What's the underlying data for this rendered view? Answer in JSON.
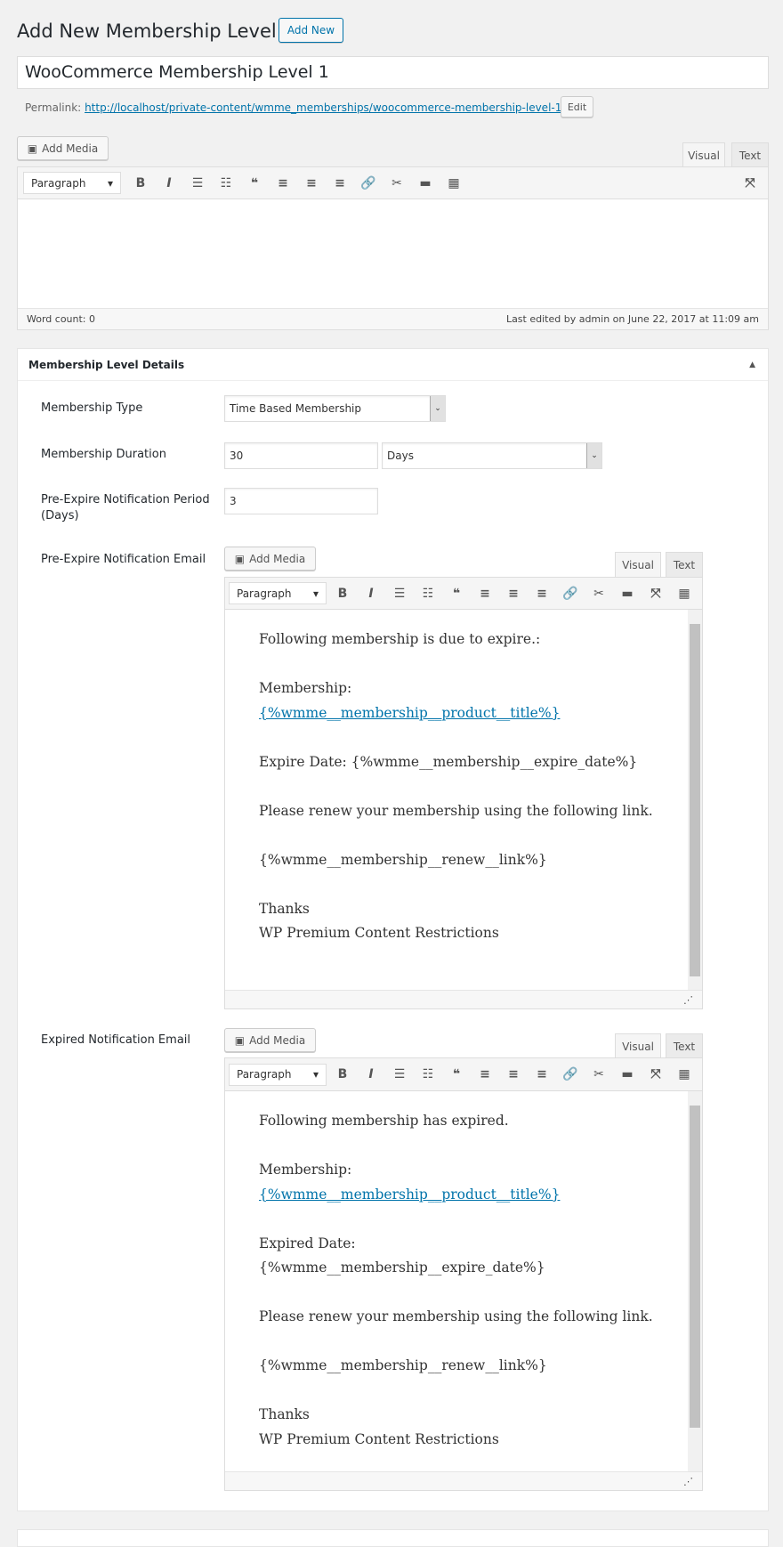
{
  "page": {
    "title": "Add New Membership Level",
    "add_new": "Add New"
  },
  "post_title": "WooCommerce Membership Level 1",
  "permalink": {
    "label": "Permalink:",
    "url": "http://localhost/private-content/wmme_memberships/woocommerce-membership-level-1/",
    "edit": "Edit"
  },
  "editor": {
    "add_media": "Add Media",
    "tab_visual": "Visual",
    "tab_text": "Text",
    "format": "Paragraph",
    "word_count": "Word count: 0",
    "last_edited": "Last edited by admin on June 22, 2017 at 11:09 am"
  },
  "box": {
    "title": "Membership Level Details",
    "type_label": "Membership Type",
    "type_value": "Time Based Membership",
    "duration_label": "Membership Duration",
    "duration_value": "30",
    "duration_unit": "Days",
    "period_label": "Pre-Expire Notification Period (Days)",
    "period_value": "3",
    "pre_email_label": "Pre-Expire Notification Email",
    "exp_email_label": "Expired Notification Email"
  },
  "pre_email": {
    "p1": "Following membership is due to expire.:",
    "p2a": "Membership:",
    "p2b": "{%wmme__membership__product__title%}",
    "p3": "Expire Date: {%wmme__membership__expire_date%}",
    "p4": "Please renew your membership using the following link.",
    "p5": "{%wmme__membership__renew__link%}",
    "p6a": "Thanks",
    "p6b": "WP Premium Content Restrictions"
  },
  "exp_email": {
    "p1": "Following membership has expired.",
    "p2a": "Membership:",
    "p2b": "{%wmme__membership__product__title%}",
    "p3a": "Expired Date:",
    "p3b": "{%wmme__membership__expire_date%}",
    "p4": "Please renew your membership using the following link.",
    "p5": "{%wmme__membership__renew__link%}",
    "p6a": "Thanks",
    "p6b": "WP Premium Content Restrictions"
  },
  "colors": {
    "link": "#0073aa",
    "background": "#f1f1f1"
  }
}
